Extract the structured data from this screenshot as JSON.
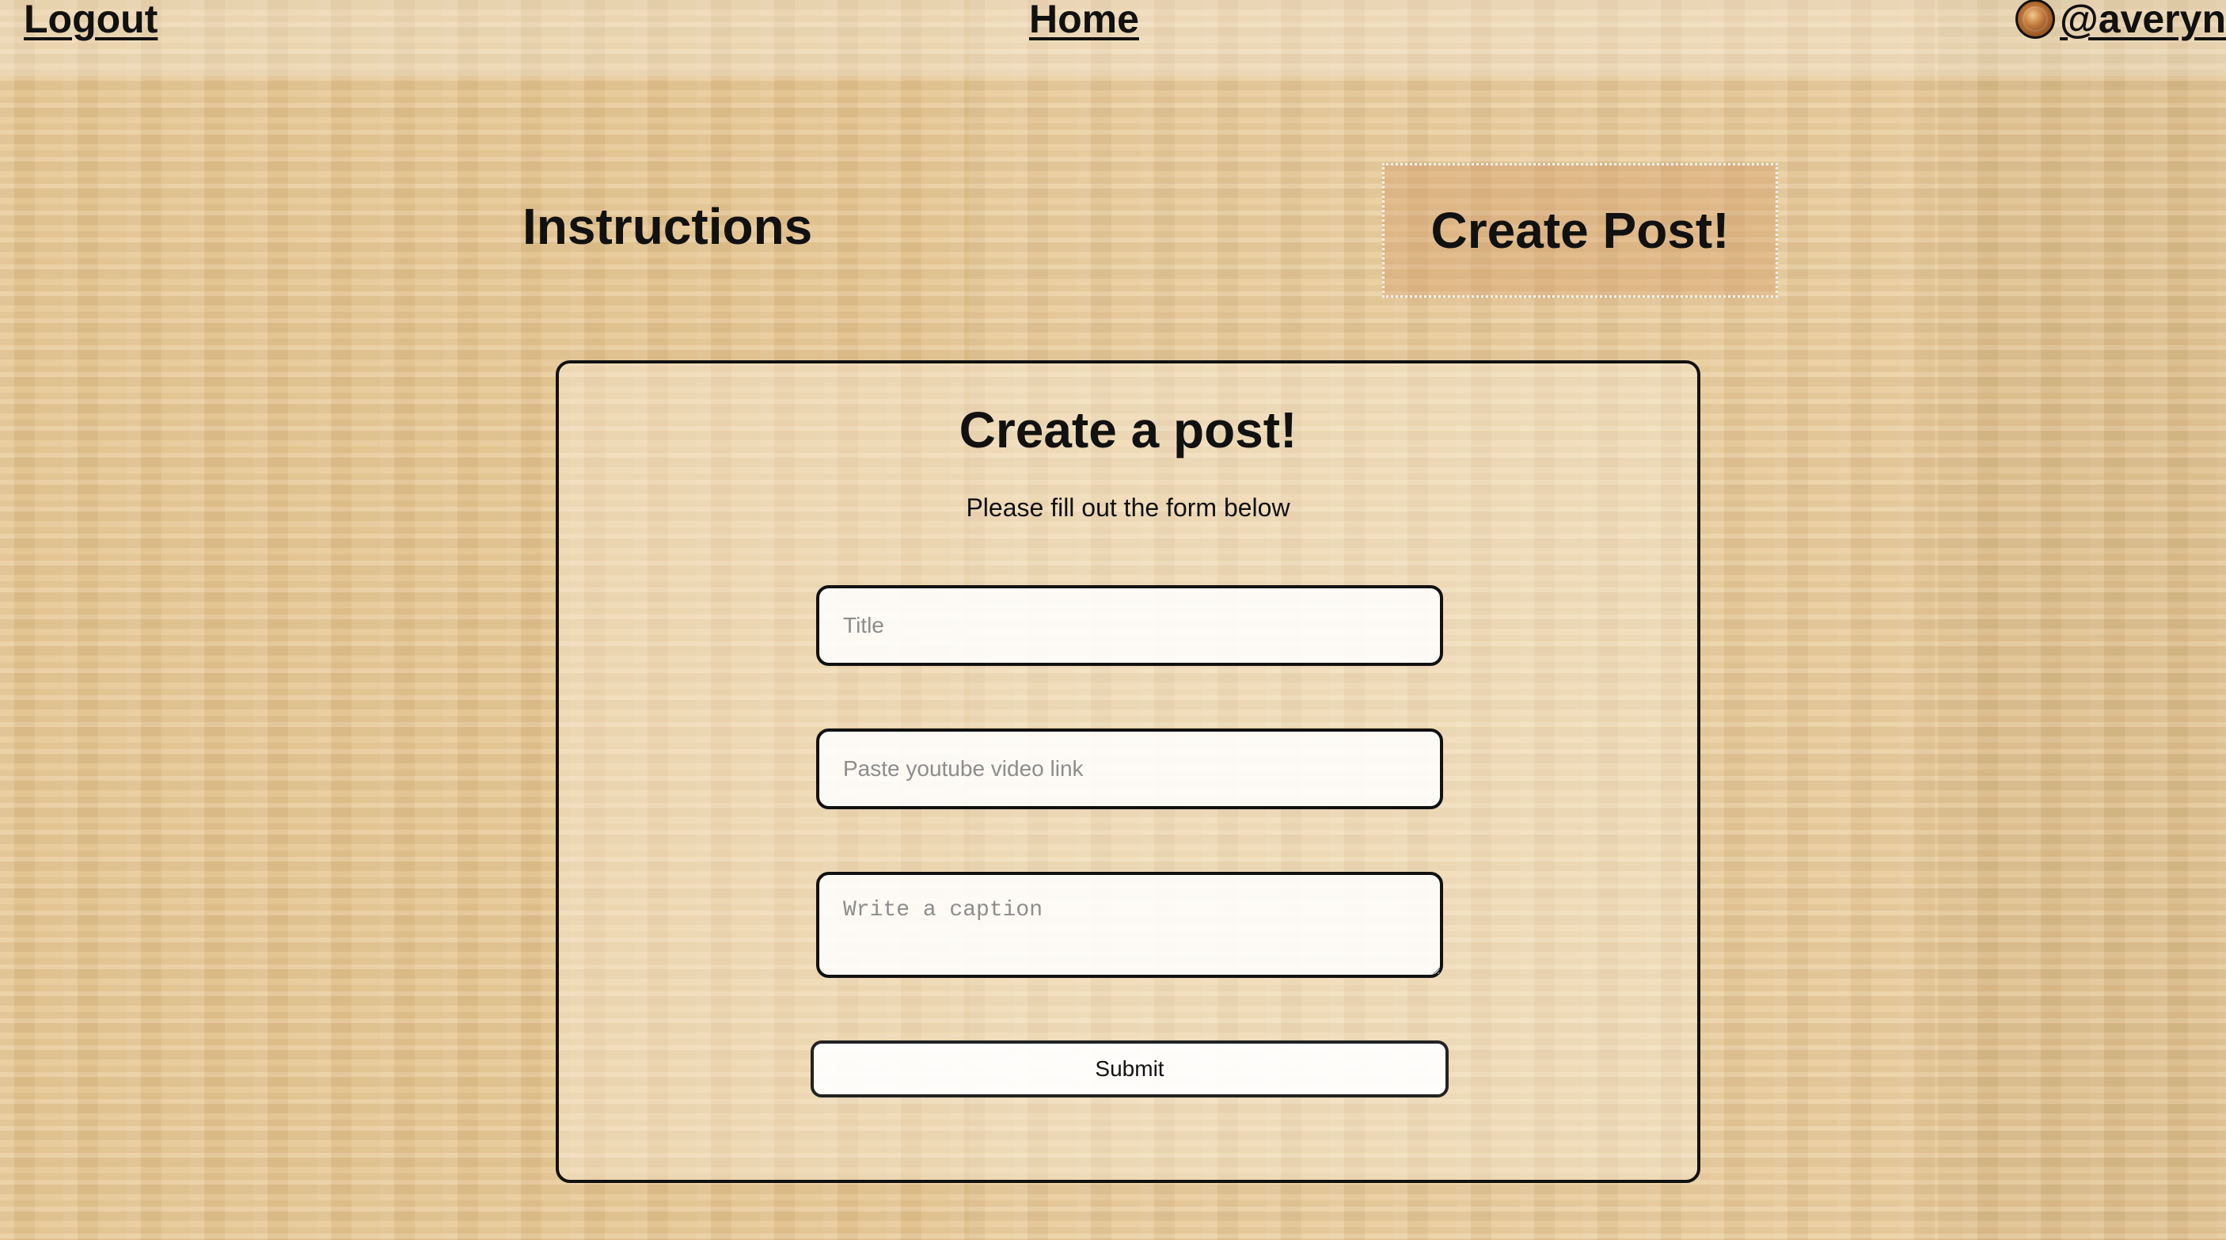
{
  "top_nav": {
    "logout": "Logout",
    "home": "Home",
    "username": "@averynov"
  },
  "section_nav": {
    "instructions": "Instructions",
    "create_post": "Create Post!"
  },
  "form": {
    "title": "Create a post!",
    "subtitle": "Please fill out the form below",
    "title_placeholder": "Title",
    "video_placeholder": "Paste youtube video link",
    "caption_placeholder": "Write a caption",
    "submit_label": "Submit"
  },
  "icons": {
    "avatar": "profile-avatar-icon"
  }
}
